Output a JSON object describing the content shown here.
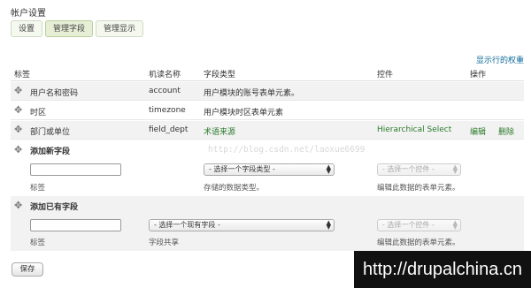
{
  "page_title": "帐户设置",
  "tabs": [
    "设置",
    "管理字段",
    "管理显示"
  ],
  "show_row_weights": "显示行的权重",
  "columns": {
    "label": "标签",
    "machine_name": "机读名称",
    "field_type": "字段类型",
    "widget": "控件",
    "operations": "操作"
  },
  "rows": [
    {
      "label": "用户名和密码",
      "machine": "account",
      "type": "用户模块的账号表单元素。",
      "widget": "",
      "edit": "",
      "delete": ""
    },
    {
      "label": "时区",
      "machine": "timezone",
      "type": "用户模块时区表单元素",
      "widget": "",
      "edit": "",
      "delete": ""
    },
    {
      "label": "部门或单位",
      "machine": "field_dept",
      "type": "术语来源",
      "widget": "Hierarchical Select",
      "edit": "编辑",
      "delete": "删除"
    }
  ],
  "add_new_field": {
    "title": "添加新字段",
    "label_desc": "标签",
    "type_select": "- 选择一个字段类型 -",
    "type_desc": "存储的数据类型。",
    "widget_select": "- 选择一个控件 -",
    "widget_desc": "编辑此数据的表单元素。"
  },
  "add_existing_field": {
    "title": "添加已有字段",
    "label_desc": "标签",
    "field_select": "- 选择一个现有字段 -",
    "field_desc": "字段共享",
    "widget_select": "- 选择一个控件 -",
    "widget_desc": "编辑此数据的表单元素。"
  },
  "save_label": "保存",
  "watermark": "http://blog.csdn.net/laoxue6699",
  "brand": "http://drupalchina.cn"
}
